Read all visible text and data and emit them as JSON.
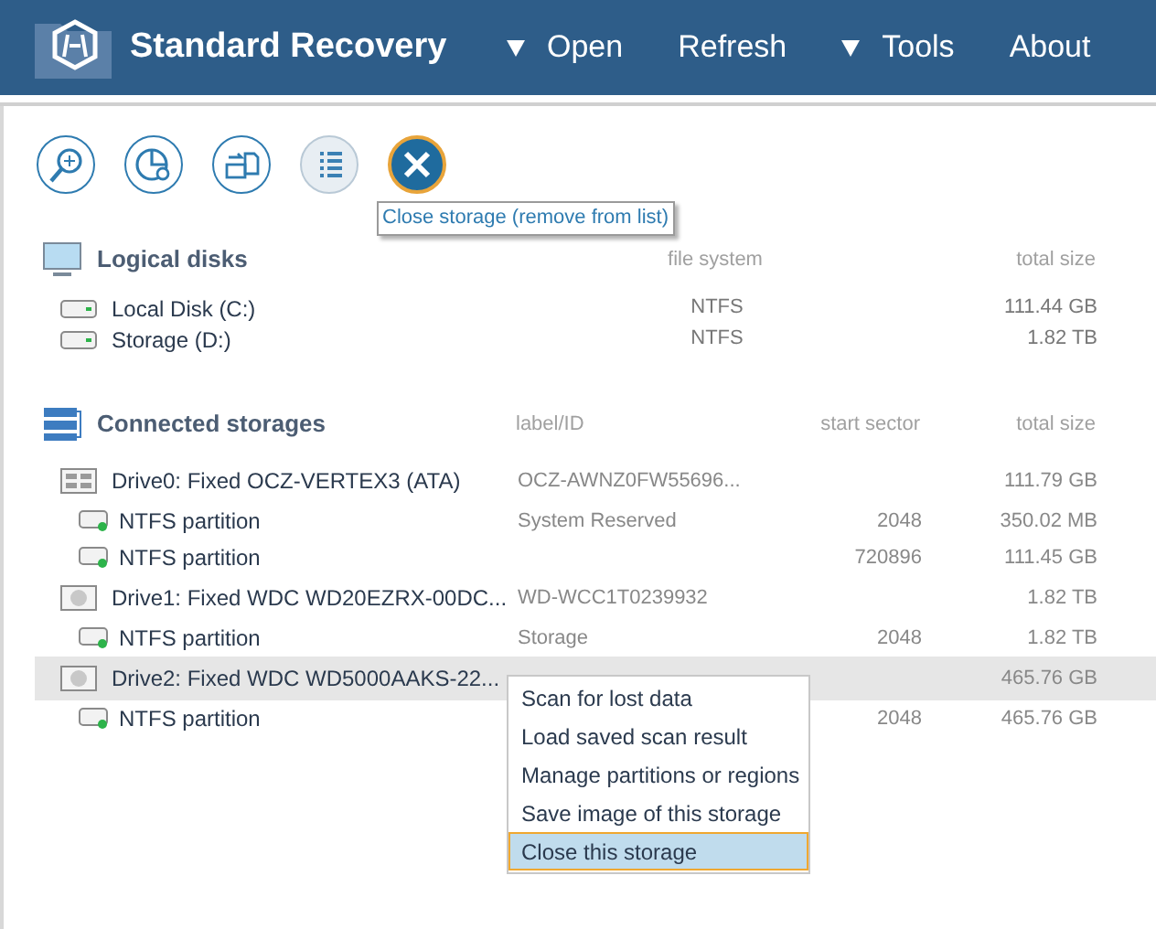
{
  "header": {
    "app_title": "Standard Recovery",
    "menu": [
      {
        "label": "Open",
        "dropdown": true
      },
      {
        "label": "Refresh",
        "dropdown": false
      },
      {
        "label": "Tools",
        "dropdown": true
      },
      {
        "label": "About",
        "dropdown": false
      }
    ]
  },
  "toolbar": {
    "buttons": [
      {
        "kind": "scan",
        "disabled": false,
        "highlighted": false
      },
      {
        "kind": "partitions",
        "disabled": false,
        "highlighted": false
      },
      {
        "kind": "image",
        "disabled": false,
        "highlighted": false
      },
      {
        "kind": "list",
        "disabled": true,
        "highlighted": false
      },
      {
        "kind": "close",
        "disabled": false,
        "highlighted": true
      }
    ],
    "tooltip": "Close storage (remove from list)"
  },
  "logical_disks": {
    "title": "Logical disks",
    "columns": [
      "file system",
      "total size"
    ],
    "rows": [
      {
        "name": "Local Disk (C:)",
        "file_system": "NTFS",
        "total_size": "111.44 GB"
      },
      {
        "name": "Storage (D:)",
        "file_system": "NTFS",
        "total_size": "1.82 TB"
      }
    ]
  },
  "connected_storages": {
    "title": "Connected storages",
    "columns": [
      "label/ID",
      "start sector",
      "total size"
    ],
    "drives": [
      {
        "kind": "ssd",
        "name": "Drive0: Fixed OCZ-VERTEX3 (ATA)",
        "label": "OCZ-AWNZ0FW55696...",
        "total_size": "111.79 GB",
        "selected": false,
        "children": [
          {
            "name": "NTFS partition",
            "label": "System Reserved",
            "start_sector": "2048",
            "total_size": "350.02 MB"
          },
          {
            "name": "NTFS partition",
            "start_sector": "720896",
            "total_size": "111.45 GB"
          }
        ]
      },
      {
        "kind": "hdd",
        "name": "Drive1: Fixed WDC WD20EZRX-00DC...",
        "label": "WD-WCC1T0239932",
        "total_size": "1.82 TB",
        "selected": false,
        "children": [
          {
            "name": "NTFS partition",
            "label": "Storage",
            "start_sector": "2048",
            "total_size": "1.82 TB"
          }
        ]
      },
      {
        "kind": "hdd",
        "name": "Drive2: Fixed WDC WD5000AAKS-22...",
        "total_size": "465.76 GB",
        "selected": true,
        "children": [
          {
            "name": "NTFS partition",
            "start_sector": "2048",
            "total_size": "465.76 GB"
          }
        ]
      }
    ]
  },
  "context_menu": {
    "items": [
      {
        "label": "Scan for lost data",
        "selected": false
      },
      {
        "label": "Load saved scan result",
        "selected": false
      },
      {
        "label": "Manage partitions or regions",
        "selected": false
      },
      {
        "label": "Save image of this storage",
        "selected": false
      },
      {
        "label": "Close this storage",
        "selected": true
      }
    ]
  }
}
